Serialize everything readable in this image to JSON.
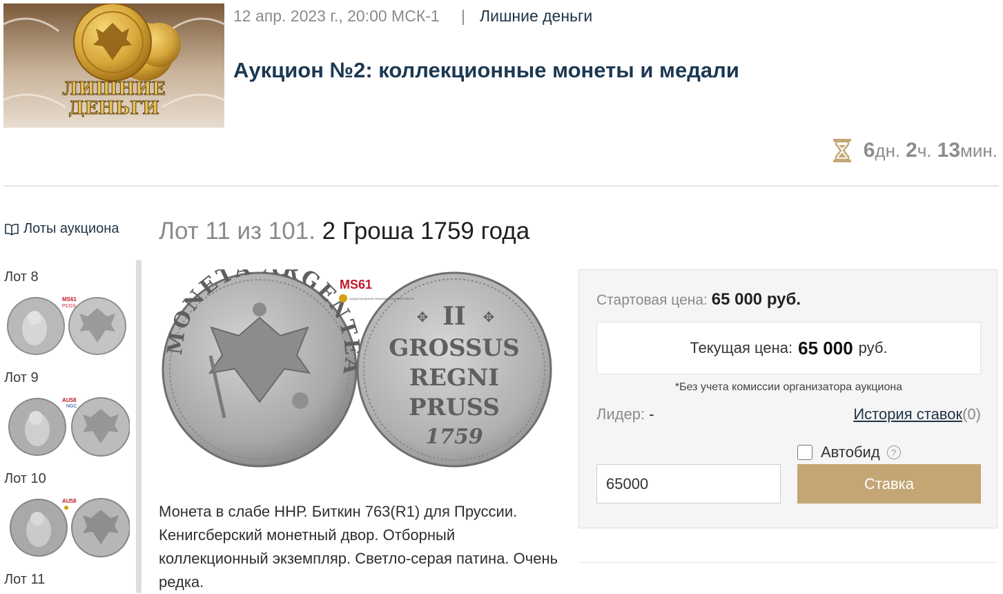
{
  "header": {
    "logo_text": "ЛИШНИЕ ДЕНЬГИ",
    "date": "12 апр. 2023 г., 20:00 МСК-1",
    "separator": "|",
    "organizer": "Лишние деньги",
    "auction_title": "Аукцион №2: коллекционные монеты и медали",
    "timer": {
      "icon": "hourglass-icon",
      "days": "6",
      "days_unit": "дн.",
      "hours": "2",
      "hours_unit": "ч.",
      "minutes": "13",
      "minutes_unit": "мин."
    }
  },
  "sidebar": {
    "lots_link": "Лоты аукциона",
    "lots_icon": "book-icon",
    "lots": [
      {
        "label": "Лот 8",
        "grade": "MS61",
        "grader": "PCGS"
      },
      {
        "label": "Лот 9",
        "grade": "AU58",
        "grader": "NGC"
      },
      {
        "label": "Лот 10",
        "grade": "AU58",
        "grader": ""
      },
      {
        "label": "Лот 11"
      }
    ]
  },
  "lot": {
    "counter": "Лот 11 из 101.",
    "name": "2 Гроша 1759 года",
    "image_grade": "MS61",
    "image_registry": "НАЦИОНАЛЬНЫЙ НУМИЗМАТИЧЕСКИЙ РЕЕСТР",
    "obverse_legend": "MONETA ARGENTEA",
    "reverse_lines": [
      "II",
      "GROSSUS",
      "REGNI",
      "PRUSS",
      "1759"
    ],
    "description": "Монета в слабе ННР. Биткин 763(R1) для Пруссии. Кенигсберский монетный двор. Отборный коллекционный экземпляр. Светло-серая патина. Очень редка."
  },
  "bid": {
    "start_label": "Стартовая цена:",
    "start_value": "65 000 руб.",
    "current_label": "Текущая цена:",
    "current_value": "65 000",
    "current_currency": "руб.",
    "commission_note": "*Без учета комиссии организатора аукциона",
    "leader_label": "Лидер:",
    "leader_value": "-",
    "history_link": "История ставок",
    "history_count": "(0)",
    "autobid_label": "Автобид",
    "help_symbol": "?",
    "input_value": "65000",
    "button_label": "Ставка",
    "colors": {
      "button": "#c4a675",
      "title": "#1c3852",
      "link": "#1f3346"
    }
  }
}
